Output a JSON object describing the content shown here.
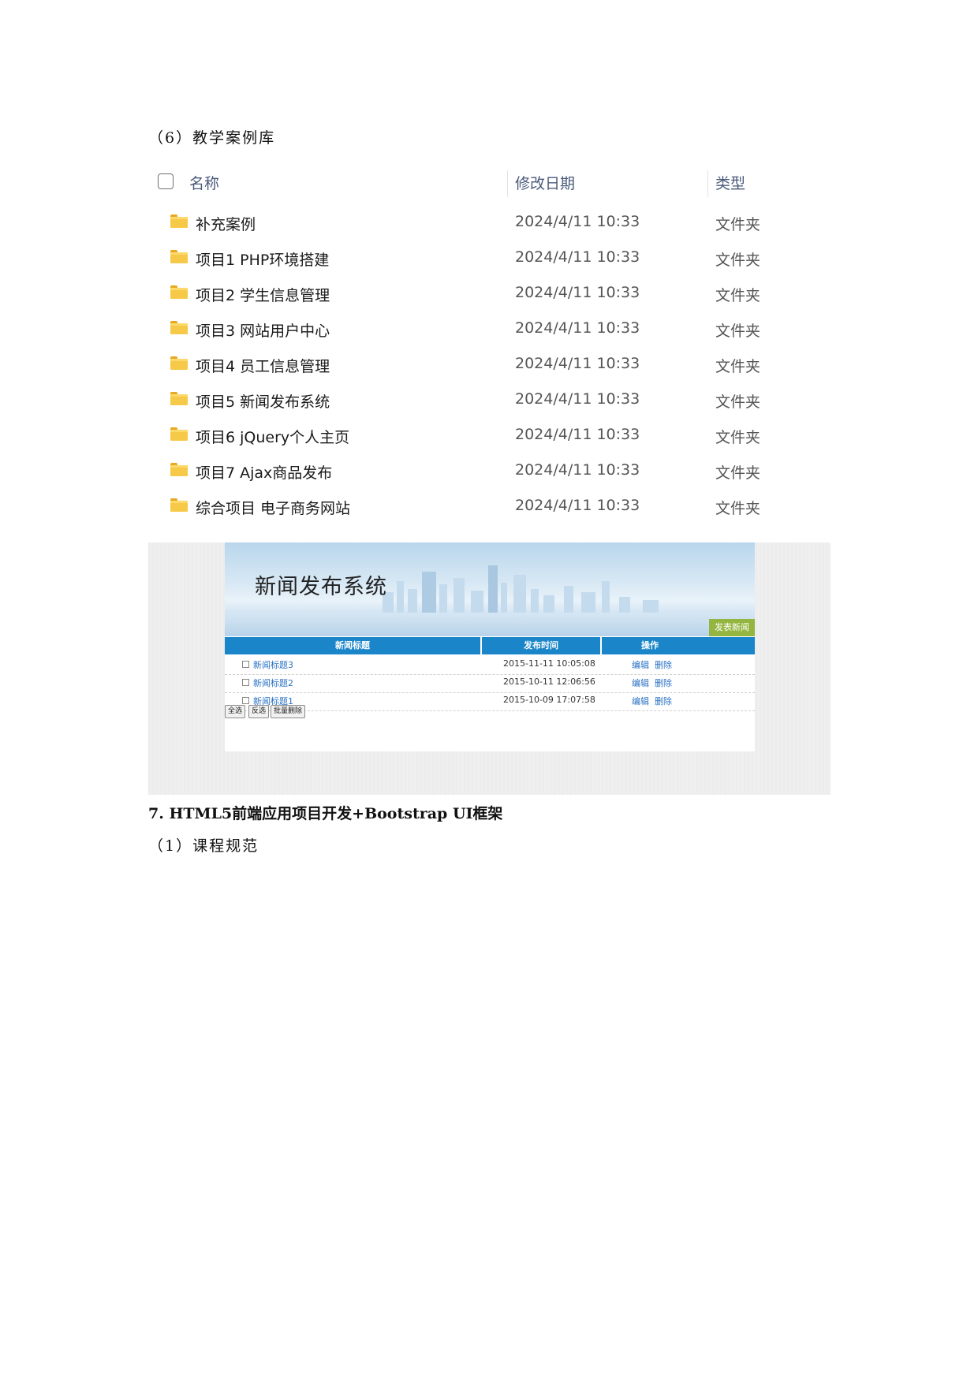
{
  "section6_heading": "（6）教学案例库",
  "explorer": {
    "columns": {
      "name": "名称",
      "date": "修改日期",
      "type": "类型"
    },
    "rows": [
      {
        "name": "补充案例",
        "date": "2024/4/11 10:33",
        "type": "文件夹"
      },
      {
        "name": "项目1 PHP环境搭建",
        "date": "2024/4/11 10:33",
        "type": "文件夹"
      },
      {
        "name": "项目2 学生信息管理",
        "date": "2024/4/11 10:33",
        "type": "文件夹"
      },
      {
        "name": "项目3 网站用户中心",
        "date": "2024/4/11 10:33",
        "type": "文件夹"
      },
      {
        "name": "项目4 员工信息管理",
        "date": "2024/4/11 10:33",
        "type": "文件夹"
      },
      {
        "name": "项目5 新闻发布系统",
        "date": "2024/4/11 10:33",
        "type": "文件夹"
      },
      {
        "name": "项目6 jQuery个人主页",
        "date": "2024/4/11 10:33",
        "type": "文件夹"
      },
      {
        "name": "项目7 Ajax商品发布",
        "date": "2024/4/11 10:33",
        "type": "文件夹"
      },
      {
        "name": "综合项目 电子商务网站",
        "date": "2024/4/11 10:33",
        "type": "文件夹"
      }
    ],
    "folder_icon": "folder-icon",
    "folder_color": "#f7c948"
  },
  "news_app": {
    "title": "新闻发布系统",
    "publish_button": "发表新闻",
    "columns": {
      "title": "新闻标题",
      "time": "发布时间",
      "ops": "操作"
    },
    "rows": [
      {
        "title": "新闻标题3",
        "time": "2015-11-11 10:05:08",
        "edit": "编辑",
        "delete": "删除"
      },
      {
        "title": "新闻标题2",
        "time": "2015-10-11 12:06:56",
        "edit": "编辑",
        "delete": "删除"
      },
      {
        "title": "新闻标题1",
        "time": "2015-10-09 17:07:58",
        "edit": "编辑",
        "delete": "删除"
      }
    ],
    "buttons": {
      "select_all": "全选",
      "invert": "反选",
      "batch_delete": "批量删除"
    },
    "header_color": "#1a86c9",
    "button_color": "#94b640"
  },
  "section7_heading": "7.  HTML5前端应用项目开发+Bootstrap UI框架",
  "section7_sub": "（1）课程规范"
}
